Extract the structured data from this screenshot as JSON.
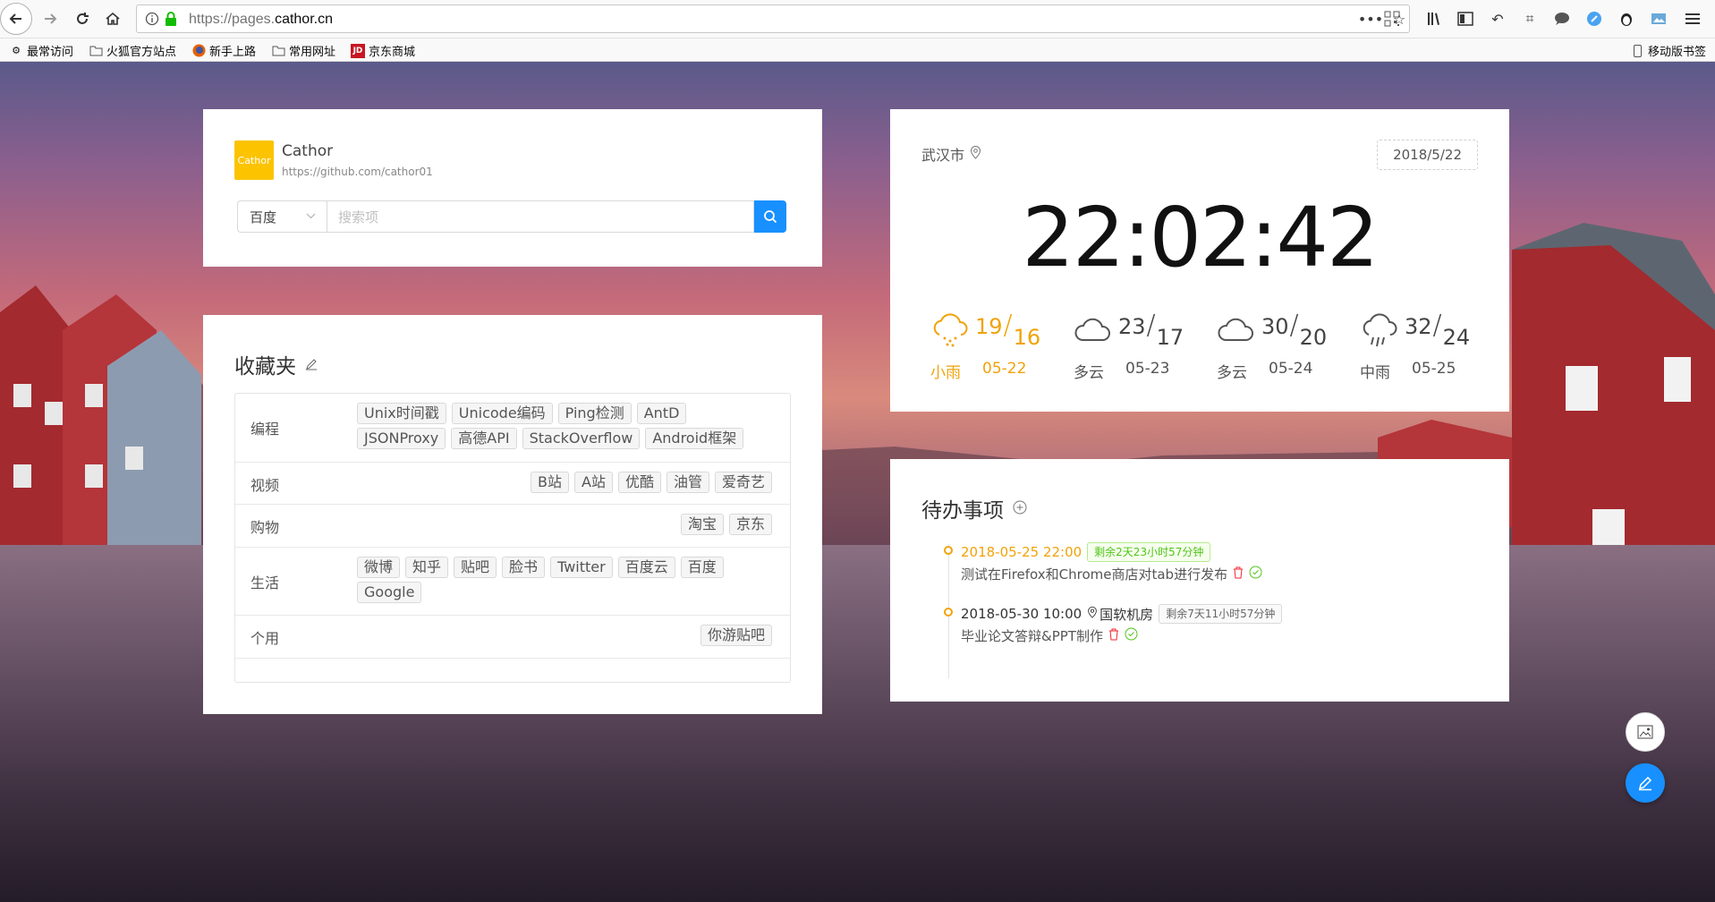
{
  "browser": {
    "url_prefix": "https://pages.",
    "url_domain": "cathor.cn",
    "bookmarks": [
      {
        "label": "最常访问",
        "icon": "gear-icon"
      },
      {
        "label": "火狐官方站点",
        "icon": "folder-icon"
      },
      {
        "label": "新手上路",
        "icon": "firefox-icon"
      },
      {
        "label": "常用网址",
        "icon": "folder-icon"
      },
      {
        "label": "京东商城",
        "icon": "jd-icon"
      }
    ],
    "mobile_bookmarks": "移动版书签"
  },
  "search": {
    "logo_text": "Cathor",
    "site_name": "Cathor",
    "site_url": "https://github.com/cathor01",
    "engine": "百度",
    "placeholder": "搜索项"
  },
  "favorites": {
    "title": "收藏夹",
    "rows": [
      {
        "category": "编程",
        "tags": [
          "Unix时间戳",
          "Unicode编码",
          "Ping检测",
          "AntD",
          "JSONProxy",
          "高德API",
          "StackOverflow",
          "Android框架"
        ]
      },
      {
        "category": "视频",
        "tags": [
          "B站",
          "A站",
          "优酷",
          "油管",
          "爱奇艺"
        ]
      },
      {
        "category": "购物",
        "tags": [
          "淘宝",
          "京东"
        ]
      },
      {
        "category": "生活",
        "tags": [
          "微博",
          "知乎",
          "贴吧",
          "脸书",
          "Twitter",
          "百度云",
          "百度",
          "Google"
        ]
      },
      {
        "category": "个用",
        "tags": [
          "你游贴吧"
        ]
      }
    ]
  },
  "clock": {
    "city": "武汉市",
    "date": "2018/5/22",
    "time": "22:02:42",
    "forecast": [
      {
        "high": "19",
        "low": "16",
        "desc": "小雨",
        "day": "05-22",
        "icon": "light-rain-icon",
        "active": true
      },
      {
        "high": "23",
        "low": "17",
        "desc": "多云",
        "day": "05-23",
        "icon": "cloud-icon",
        "active": false
      },
      {
        "high": "30",
        "low": "20",
        "desc": "多云",
        "day": "05-24",
        "icon": "cloud-icon",
        "active": false
      },
      {
        "high": "32",
        "low": "24",
        "desc": "中雨",
        "day": "05-25",
        "icon": "rain-icon",
        "active": false
      }
    ]
  },
  "todo": {
    "title": "待办事项",
    "items": [
      {
        "time": "2018-05-25 22:00",
        "remaining": "剩余2天23小时57分钟",
        "location": "",
        "text": "测试在Firefox和Chrome商店对tab进行发布"
      },
      {
        "time": "2018-05-30 10:00",
        "remaining": "剩余7天11小时57分钟",
        "location": "国软机房",
        "text": "毕业论文答辩&PPT制作"
      }
    ]
  },
  "colors": {
    "accent": "#1890ff",
    "warning": "#f0a30a",
    "success": "#52c41a",
    "logo_bg": "#fcc301"
  }
}
